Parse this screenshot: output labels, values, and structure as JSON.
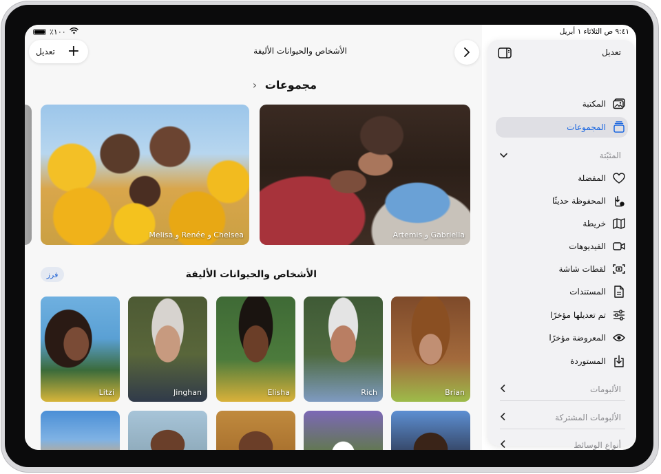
{
  "status": {
    "battery": "٪١٠٠",
    "time_date": "٩:٤١ ص  الثلاثاء ١ أبريل"
  },
  "toolbar": {
    "edit_label": "تعديل",
    "add_label": "+",
    "title": "الأشخاص والحيوانات الأليفة",
    "forward_label": "›"
  },
  "collections": {
    "heading": "مجموعات",
    "cards": [
      {
        "label": "Gabriella و Artemis"
      },
      {
        "label": "Chelsea و Renée و Melisa"
      }
    ]
  },
  "people": {
    "heading": "الأشخاص والحيوانات الأليفة",
    "sort_label": "فرز",
    "names": [
      "Brian",
      "Rich",
      "Elisha",
      "Jinghan",
      "Litzi"
    ]
  },
  "sidebar": {
    "edit_label": "تعديل",
    "library_label": "المكتبة",
    "collections_label": "المجموعات",
    "pinned_label": "المثبّتة",
    "pinned_items": [
      {
        "label": "المفضلة",
        "icon": "heart-icon"
      },
      {
        "label": "المحفوظة حديثًا",
        "icon": "recently-saved-icon"
      },
      {
        "label": "خريطة",
        "icon": "map-icon"
      },
      {
        "label": "الفيديوهات",
        "icon": "video-icon"
      },
      {
        "label": "لقطات شاشة",
        "icon": "screenshot-icon"
      },
      {
        "label": "المستندات",
        "icon": "document-icon"
      },
      {
        "label": "تم تعديلها مؤخرًا",
        "icon": "sliders-icon"
      },
      {
        "label": "المعروضة مؤخرًا",
        "icon": "eye-icon"
      },
      {
        "label": "المستوردة",
        "icon": "import-icon"
      }
    ],
    "groups": [
      {
        "label": "الألبومات"
      },
      {
        "label": "الألبومات المشتركة"
      },
      {
        "label": "أنواع الوسائط"
      }
    ]
  },
  "colors": {
    "accent": "#1a66e0"
  }
}
